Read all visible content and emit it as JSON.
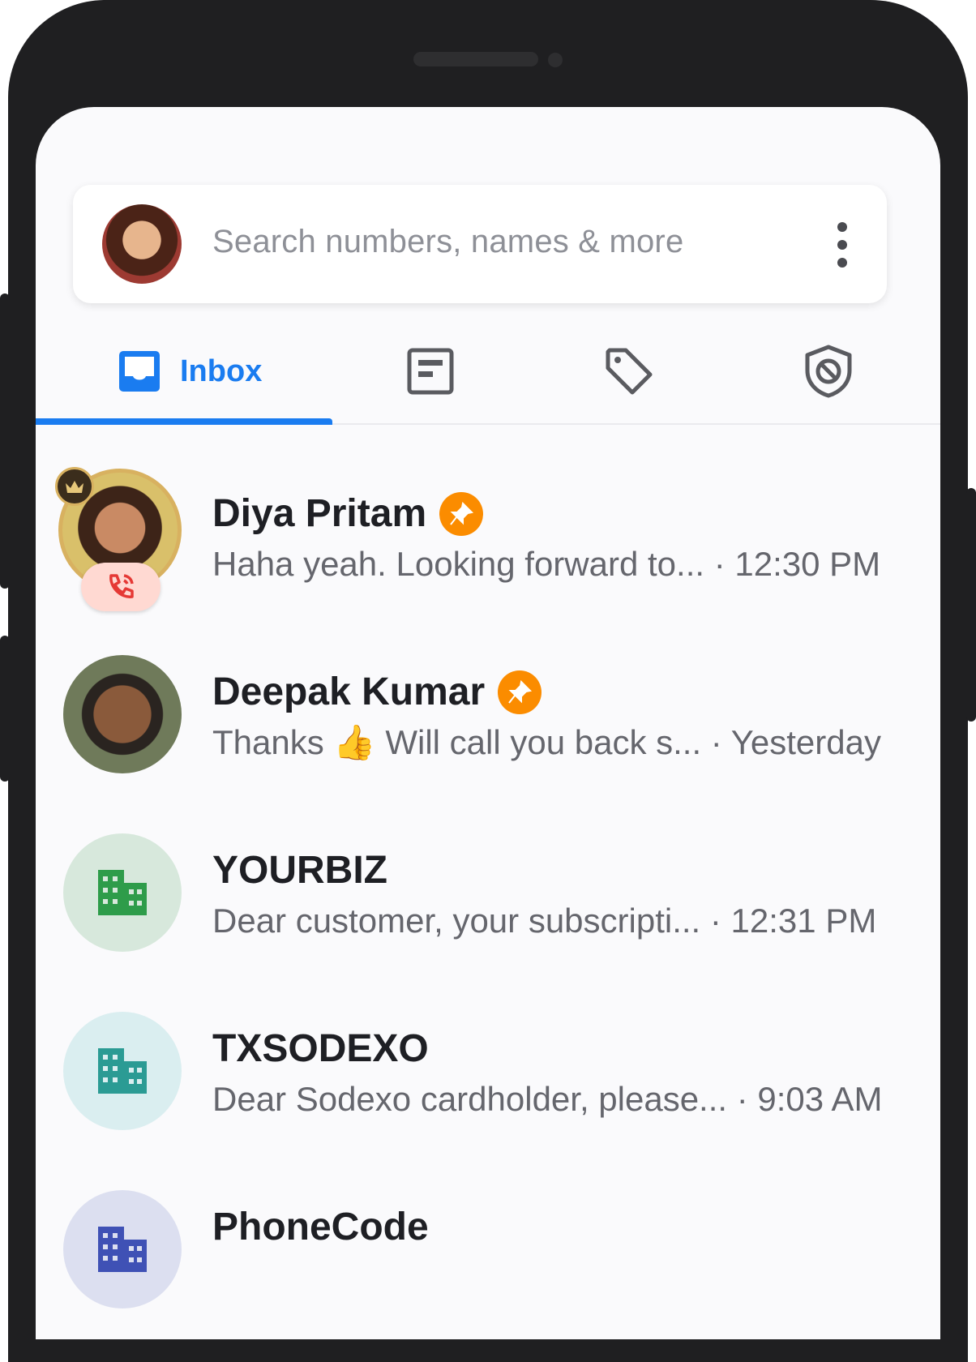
{
  "search": {
    "placeholder": "Search numbers, names & more"
  },
  "tabs": {
    "inbox_label": "Inbox"
  },
  "colors": {
    "accent": "#1a7cf0",
    "pin": "#fb8c00",
    "call_badge": "#ffd9d2"
  },
  "conversations": [
    {
      "name": "Diya Pritam",
      "pinned": true,
      "preview": "Haha yeah. Looking forward to...",
      "time": "12:30 PM"
    },
    {
      "name": "Deepak Kumar",
      "pinned": true,
      "preview": "Thanks 👍 Will call you back s...",
      "time": "Yesterday"
    },
    {
      "name": "YOURBIZ",
      "pinned": false,
      "preview": "Dear customer, your subscripti...",
      "time": "12:31 PM"
    },
    {
      "name": "TXSODEXO",
      "pinned": false,
      "preview": "Dear Sodexo cardholder, please...",
      "time": "9:03 AM"
    },
    {
      "name": "PhoneCode",
      "pinned": false,
      "preview": "",
      "time": ""
    }
  ]
}
